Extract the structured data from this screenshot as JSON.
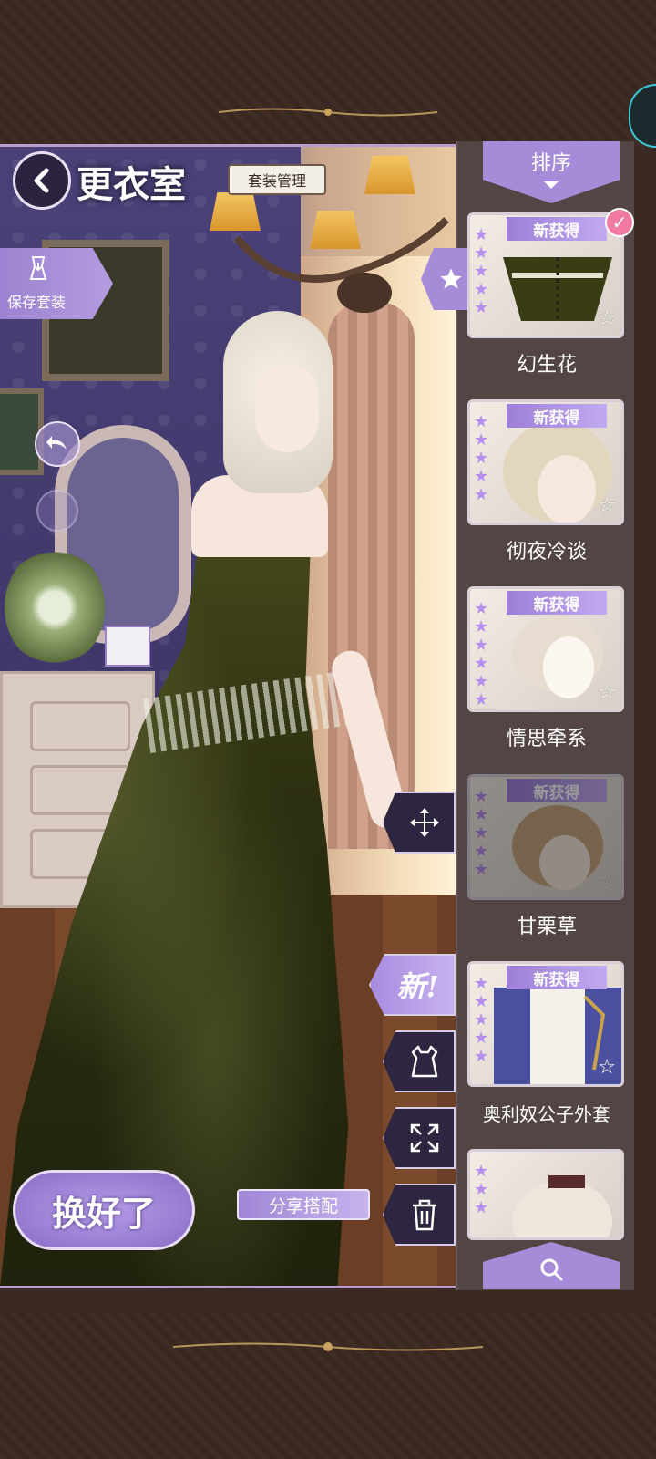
{
  "header": {
    "title": "更衣室",
    "suit_manage_label": "套装管理",
    "save_suit_label": "保存套装"
  },
  "tools": {
    "new_label": "新!"
  },
  "bottom": {
    "done_label": "换好了",
    "share_label": "分享搭配"
  },
  "panel": {
    "sort_label": "排序",
    "badge_text": "新获得",
    "items": [
      {
        "label": "幻生花",
        "selected": true
      },
      {
        "label": "彻夜冷谈",
        "selected": false
      },
      {
        "label": "情思牵系",
        "selected": false
      },
      {
        "label": "甘栗草",
        "selected": false
      },
      {
        "label": "奥利奴公子外套",
        "selected": false
      },
      {
        "label": "",
        "selected": false
      }
    ]
  },
  "colors": {
    "accent_purple": "#a68cd8",
    "frame_brown": "#3f2d25",
    "panel_bg": "#554848"
  }
}
